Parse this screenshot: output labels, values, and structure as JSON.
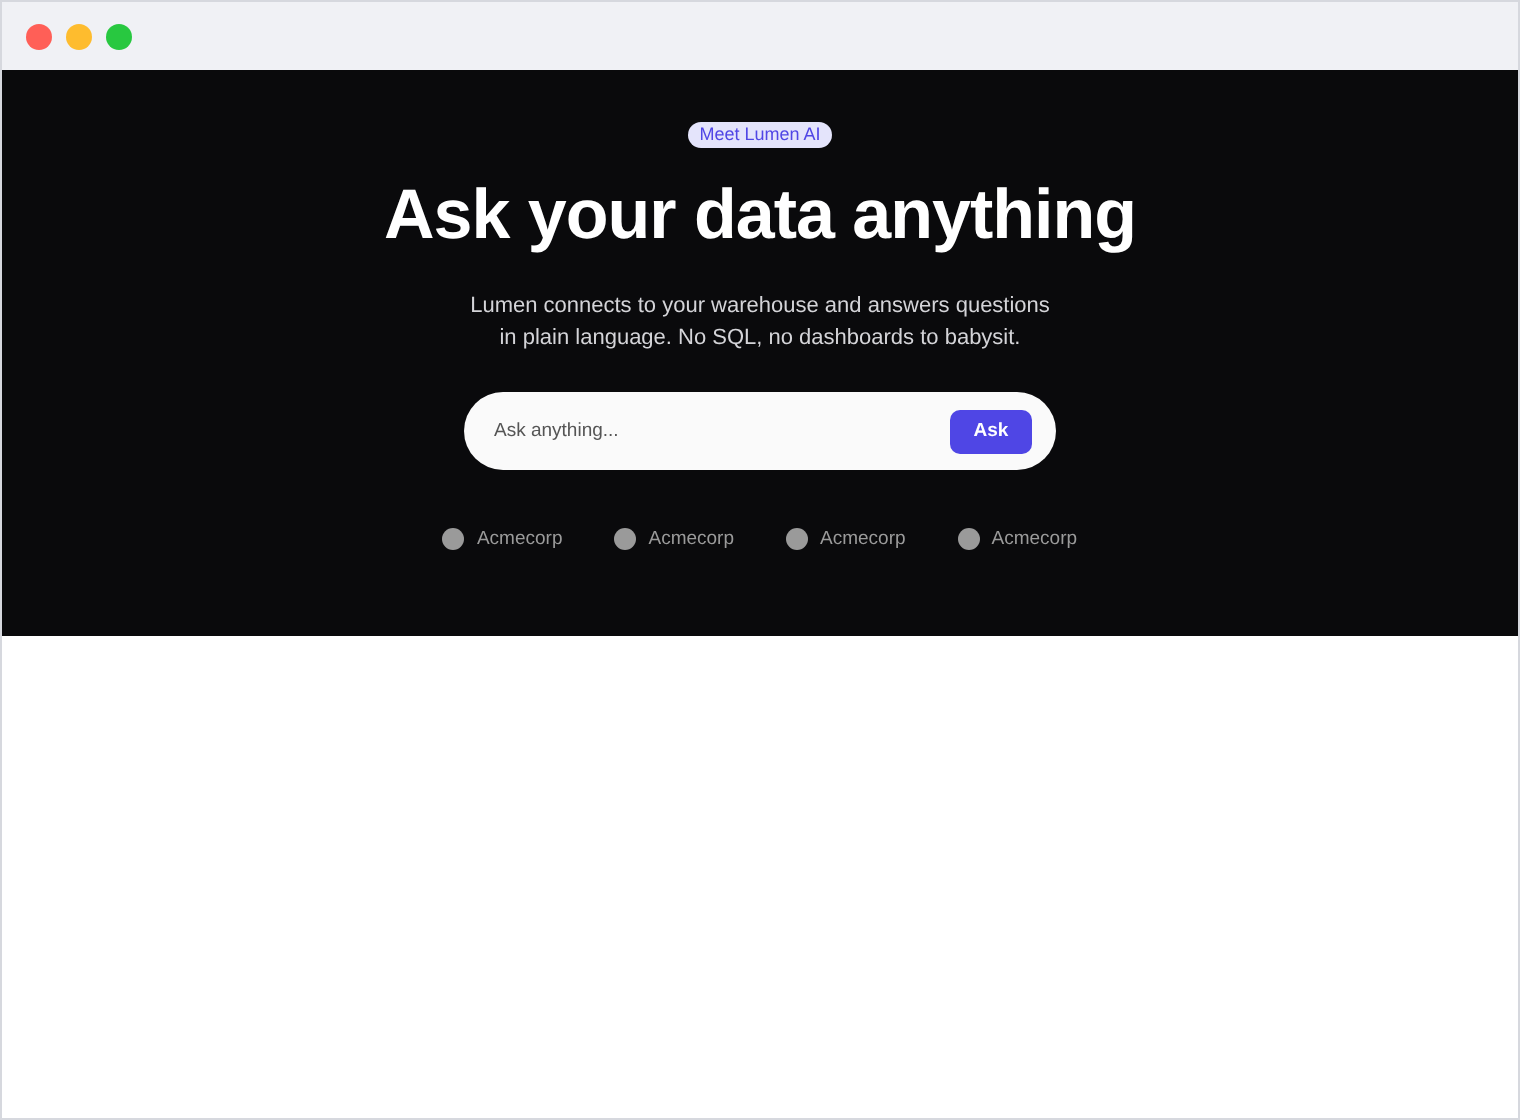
{
  "badge": "Meet Lumen AI",
  "headline": "Ask your data anything",
  "subtitle": "Lumen connects to your warehouse and answers questions in plain language. No SQL, no dashboards to babysit.",
  "search": {
    "placeholder": "Ask anything...",
    "button": "Ask"
  },
  "logos": [
    "Acmecorp",
    "Acmecorp",
    "Acmecorp",
    "Acmecorp"
  ]
}
